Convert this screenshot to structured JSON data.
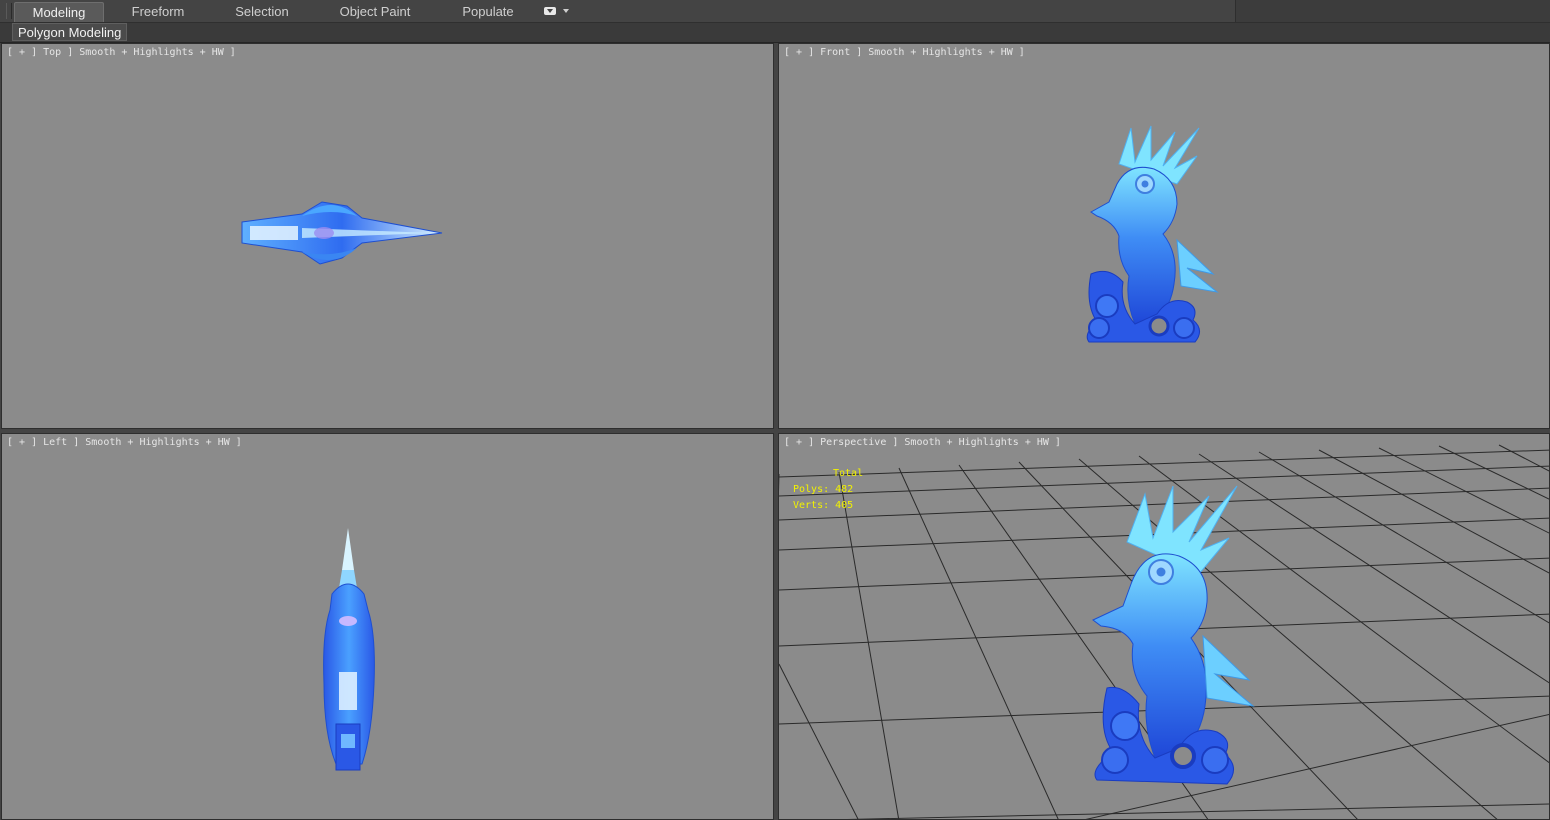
{
  "ribbon": {
    "tabs": [
      {
        "label": "Modeling",
        "active": true
      },
      {
        "label": "Freeform",
        "active": false
      },
      {
        "label": "Selection",
        "active": false
      },
      {
        "label": "Object Paint",
        "active": false
      },
      {
        "label": "Populate",
        "active": false
      }
    ],
    "options_icon": "ribbon-options-icon"
  },
  "panel": {
    "label": "Polygon Modeling"
  },
  "viewports": {
    "top": {
      "label": "[ + ] Top ] Smooth + Highlights + HW ]"
    },
    "front": {
      "label": "[ + ] Front ] Smooth + Highlights + HW ]"
    },
    "left": {
      "label": "[ + ] Left ] Smooth + Highlights + HW ]"
    },
    "perspective": {
      "label": "[ + ] Perspective ] Smooth + Highlights + HW ]"
    }
  },
  "stats": {
    "title": "Total",
    "polys": "Polys: 482",
    "verts": "Verts: 405"
  },
  "colors": {
    "viewport_bg": "#8b8b8b",
    "model_blue": "#2f6cf0",
    "model_cyan": "#7fe4ff",
    "stats_yellow": "#f2f200"
  }
}
